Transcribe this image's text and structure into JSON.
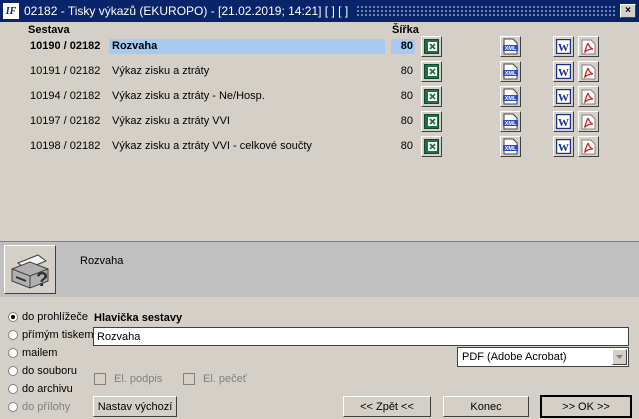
{
  "window": {
    "icon_label": "IF",
    "title": "02182 - Tisky výkazů (EKUROPO) - [21.02.2019; 14:21] [ ] [ ]",
    "close_label": "×"
  },
  "columns": {
    "sestava": "Sestava",
    "sirka": "Šířka"
  },
  "rows": [
    {
      "number": "10190 / 02182",
      "name": "Rozvaha",
      "width": "80",
      "selected": true
    },
    {
      "number": "10191 / 02182",
      "name": "Výkaz zisku a ztráty",
      "width": "80",
      "selected": false
    },
    {
      "number": "10194 / 02182",
      "name": "Výkaz zisku a ztráty - Ne/Hosp.",
      "width": "80",
      "selected": false
    },
    {
      "number": "10197 / 02182",
      "name": "Výkaz zisku a ztráty VVI",
      "width": "80",
      "selected": false
    },
    {
      "number": "10198 / 02182",
      "name": "Výkaz zisku a ztráty VVI - celkové součty",
      "width": "80",
      "selected": false
    }
  ],
  "icons": {
    "excel": "excel-icon",
    "xml": "xml-icon",
    "xml_label": "XML",
    "word": "word-icon",
    "word_label": "W",
    "pdf": "pdf-icon",
    "printer": "printer-icon",
    "printer_label": "?"
  },
  "description": "Rozvaha",
  "output": {
    "options": [
      {
        "label": "do prohlížeče",
        "selected": true,
        "disabled": false
      },
      {
        "label": "přímým tiskem",
        "selected": false,
        "disabled": false
      },
      {
        "label": "mailem",
        "selected": false,
        "disabled": false
      },
      {
        "label": "do souboru",
        "selected": false,
        "disabled": false
      },
      {
        "label": "do archivu",
        "selected": false,
        "disabled": false
      },
      {
        "label": "do přílohy",
        "selected": false,
        "disabled": true
      }
    ]
  },
  "header_section": {
    "label": "Hlavička sestavy",
    "value": "Rozvaha"
  },
  "format": {
    "selected": "PDF (Adobe Acrobat)"
  },
  "checks": {
    "el_podpis": "El. podpis",
    "el_pecet": "El. pečeť"
  },
  "buttons": {
    "defaults": "Nastav výchozí",
    "back": "<< Zpět <<",
    "end": "Konec",
    "ok": ">> OK >>"
  },
  "colors": {
    "titlebar": "#0a246a",
    "selection": "#a6caf0",
    "face": "#d4d0c8",
    "excel": "#1e7145",
    "word": "#1a2f8a",
    "pdf": "#d02020"
  }
}
